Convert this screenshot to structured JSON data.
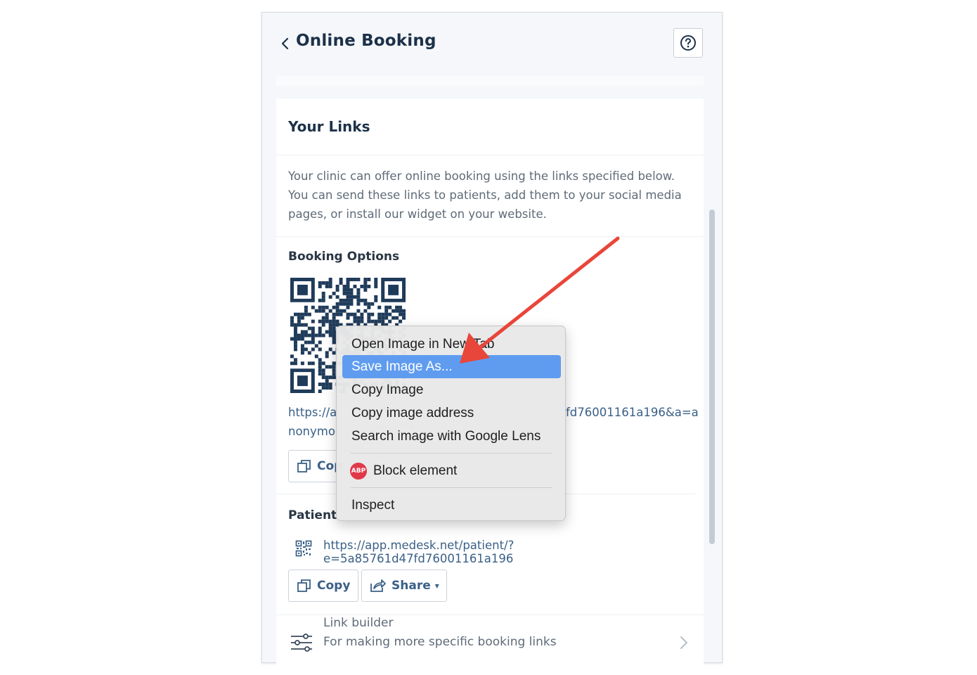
{
  "header": {
    "title": "Online Booking"
  },
  "links_card": {
    "title": "Your Links",
    "description": "Your clinic can offer online booking using the links specified below. You can send these links to patients, add them to your social media pages, or install our widget on your website.",
    "booking_options_label": "Booking Options",
    "booking_link_prefix": "https://a",
    "booking_link_suffix": "fd76001161a196&a=a",
    "booking_link_line2": "nonymo",
    "booking_copy_label": "Cop",
    "patient_label": "Patient",
    "patient_link": "https://app.medesk.net/patient/?e=5a85761d47fd76001161a196",
    "copy_label": "Copy",
    "share_label": "Share",
    "share_caret": "▾"
  },
  "link_builder": {
    "title": "Link builder",
    "subtitle": "For making more specific booking links"
  },
  "context_menu": {
    "items": [
      {
        "label": "Open Image in New Tab",
        "highlighted": false
      },
      {
        "label": "Save Image As...",
        "highlighted": true
      },
      {
        "label": "Copy Image",
        "highlighted": false
      },
      {
        "label": "Copy image address",
        "highlighted": false
      },
      {
        "label": "Search image with Google Lens",
        "highlighted": false
      },
      {
        "label": "Block element",
        "icon": "abp-icon",
        "icon_text": "ABP",
        "highlighted": false
      },
      {
        "label": "Inspect",
        "highlighted": false
      }
    ]
  },
  "colors": {
    "heading": "#1c3149",
    "link": "#3a6087",
    "menu_highlight": "#5f9cf0",
    "annotation_arrow": "#e8463a",
    "abp_badge": "#e0394a"
  }
}
